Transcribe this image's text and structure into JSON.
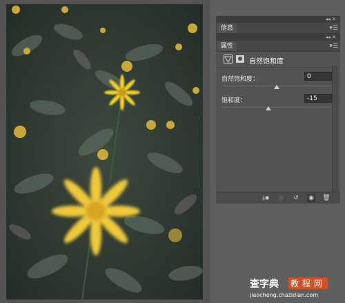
{
  "panels": {
    "info_tab": "信息",
    "properties_tab": "属性",
    "adjustment_title": "自然饱和度",
    "collapse_icon": "double-chevron-right-icon",
    "menu_icon": "panel-menu-icon"
  },
  "vibrance": {
    "label": "自然饱和度：",
    "value": "0",
    "level": 0.5
  },
  "saturation": {
    "label": "饱和度：",
    "value": "-15",
    "level": 0.425
  },
  "bottom_bar": {
    "icons": [
      "clip-to-layer-icon",
      "view-previous-icon",
      "reset-icon",
      "visibility-eye-icon",
      "delete-icon"
    ]
  },
  "watermark": {
    "main": "查字典",
    "sub": "教程网",
    "url": "jiaocheng.chazidian.com"
  },
  "photo": {
    "subject": "yellow-daisies-photo"
  }
}
